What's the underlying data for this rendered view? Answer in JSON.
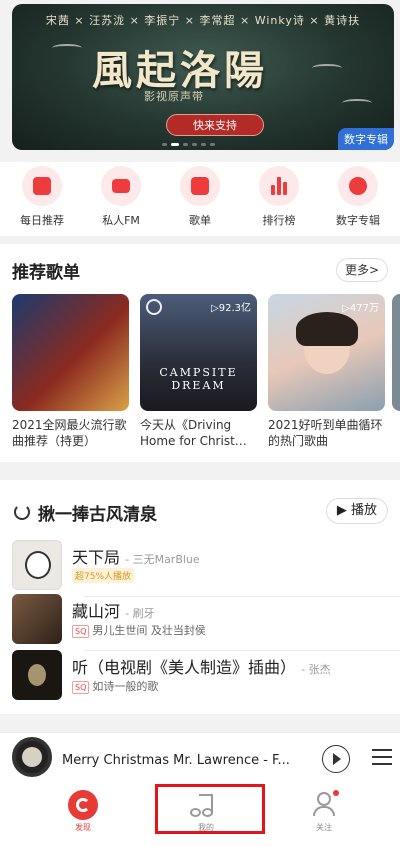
{
  "banner": {
    "artists": "宋茜 × 汪苏泷 × 李振宁 × 李常超 × Winky诗 × 黄诗扶",
    "title": "風起洛陽",
    "subtitle": "影视原声带",
    "button": "快来支持",
    "tag": "数字专辑"
  },
  "quick": [
    {
      "label": "每日推荐",
      "icon": "calendar-icon"
    },
    {
      "label": "私人FM",
      "icon": "radio-icon"
    },
    {
      "label": "歌单",
      "icon": "playlist-icon"
    },
    {
      "label": "排行榜",
      "icon": "chart-bars-icon"
    },
    {
      "label": "数字专辑",
      "icon": "album-icon"
    }
  ],
  "playlists": {
    "title": "推荐歌单",
    "more": "更多>",
    "cards": [
      {
        "name": "2021全网最火流行歌曲推荐（持更）",
        "plays": "",
        "color": "#7a2a1e"
      },
      {
        "name": "今天从《Driving Home for Christ…",
        "plays": "▷92.3亿",
        "color": "#2d2f3a",
        "overlay": "CAMPSITE DREAM"
      },
      {
        "name": "2021好听到单曲循环的热门歌曲",
        "plays": "▷477万",
        "color": "#9fb7c9"
      }
    ]
  },
  "songs": {
    "title": "揪一捧古风清泉",
    "play_all": "▶ 播放",
    "items": [
      {
        "title": "天下局",
        "artist": "- 三无MarBlue",
        "sub": "超75%人播放",
        "tag": "hot",
        "color": "#e9e6e2"
      },
      {
        "title": "藏山河",
        "artist": "- 刷牙",
        "sub": "男儿生世间 及壮当封侯",
        "tag": "SQ",
        "color": "#5a4031"
      },
      {
        "title": "听（电视剧《美人制造》插曲）",
        "artist": "- 张杰",
        "sub": "如诗一般的歌",
        "tag": "SQ",
        "color": "#1e1a16"
      }
    ]
  },
  "player": {
    "title": "Merry Christmas Mr. Lawrence - F..."
  },
  "tabs": [
    {
      "label": "发现",
      "active": true
    },
    {
      "label": "我的",
      "active": false
    },
    {
      "label": "关注",
      "active": false
    }
  ],
  "colors": {
    "accent": "#e83b35",
    "highlight": "#e4141b"
  }
}
